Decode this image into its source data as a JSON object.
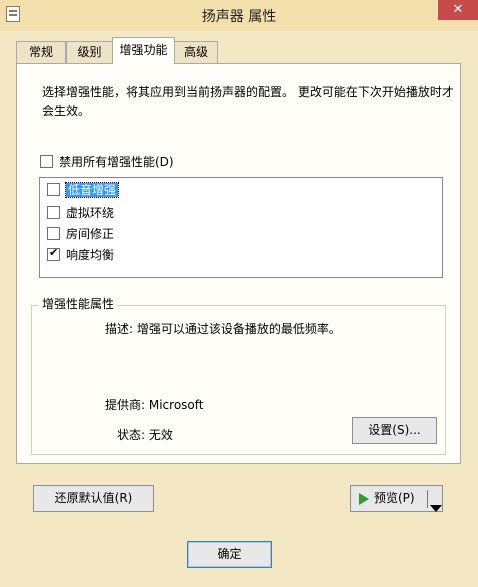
{
  "window": {
    "title": "扬声器 属性",
    "close_symbol": "✕"
  },
  "tabs": [
    {
      "label": "常规",
      "active": false
    },
    {
      "label": "级别",
      "active": false
    },
    {
      "label": "增强功能",
      "active": true
    },
    {
      "label": "高级",
      "active": false
    }
  ],
  "enhancements": {
    "description": "选择增强性能，将其应用到当前扬声器的配置。 更改可能在下次开始播放时才会生效。",
    "disable_all_label": "禁用所有增强性能(D)",
    "disable_all_checked": false,
    "items": [
      {
        "label": "低音增强",
        "checked": false,
        "selected": true
      },
      {
        "label": "虚拟环绕",
        "checked": false,
        "selected": false
      },
      {
        "label": "房间修正",
        "checked": false,
        "selected": false
      },
      {
        "label": "响度均衡",
        "checked": true,
        "selected": false
      }
    ]
  },
  "properties": {
    "group_title": "增强性能属性",
    "description": "描述: 增强可以通过该设备播放的最低频率。",
    "provider": "提供商: Microsoft",
    "status": "状态: 无效",
    "settings_button": "设置(S)..."
  },
  "buttons": {
    "restore_defaults": "还原默认值(R)",
    "preview": "预览(P)",
    "ok": "确定"
  },
  "check_symbol": "✔"
}
